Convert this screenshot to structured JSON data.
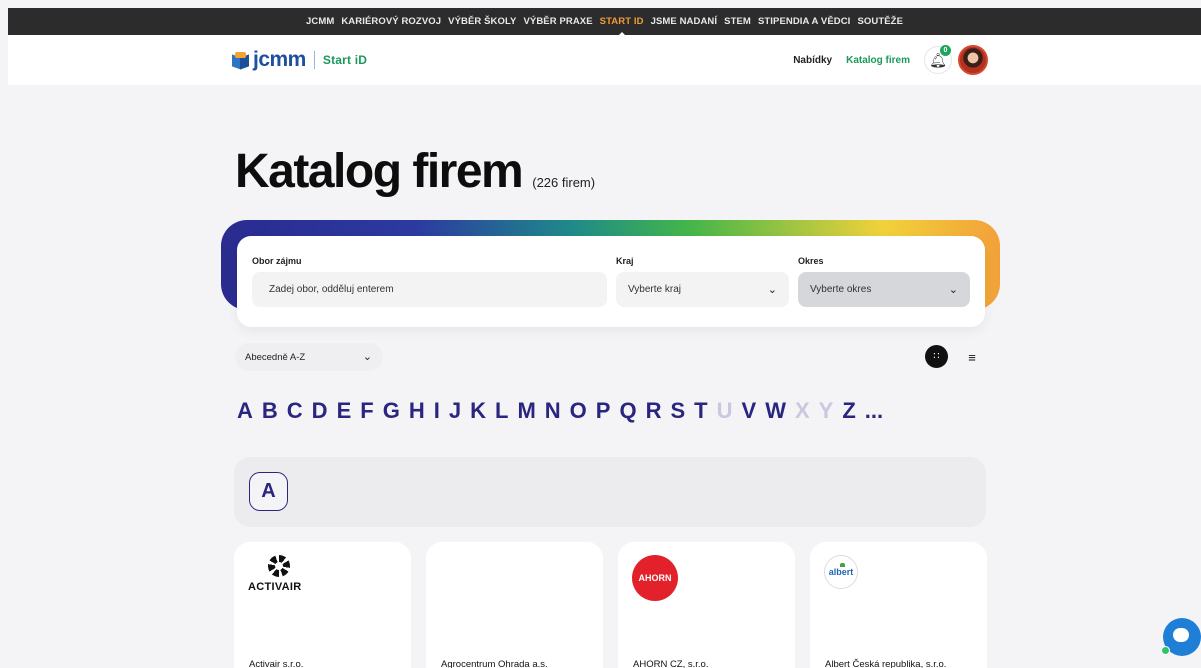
{
  "topnav": {
    "items": [
      {
        "label": "JCMM",
        "active": false
      },
      {
        "label": "KARIÉROVÝ ROZVOJ",
        "active": false
      },
      {
        "label": "VÝBĚR ŠKOLY",
        "active": false
      },
      {
        "label": "VÝBĚR PRAXE",
        "active": false
      },
      {
        "label": "START ID",
        "active": true
      },
      {
        "label": "JSME NADANÍ",
        "active": false
      },
      {
        "label": "STEM",
        "active": false
      },
      {
        "label": "STIPENDIA A VĚDCI",
        "active": false
      },
      {
        "label": "SOUTĚŽE",
        "active": false
      }
    ],
    "active_color": "#f39a3c"
  },
  "header": {
    "logo_text": "jcmm",
    "logo_sub": "Start iD",
    "links": [
      {
        "label": "Nabídky",
        "active": false
      },
      {
        "label": "Katalog firem",
        "active": true
      }
    ],
    "notification_count": "0",
    "bell_icon": "bell-icon",
    "accent": "#1a9a5a"
  },
  "page": {
    "title": "Katalog firem",
    "count": "(226 firem)"
  },
  "filters": {
    "interest_label": "Obor zájmu",
    "interest_placeholder": "Zadej obor, odděluj enterem",
    "region_label": "Kraj",
    "region_value": "Vyberte kraj",
    "district_label": "Okres",
    "district_value": "Vyberte okres"
  },
  "sort": {
    "value": "Abecedně A-Z"
  },
  "view_toggle": {
    "grid_icon": "grid-icon",
    "list_icon": "list-icon",
    "active": "grid"
  },
  "alphabet": [
    {
      "letter": "A",
      "enabled": true
    },
    {
      "letter": "B",
      "enabled": true
    },
    {
      "letter": "C",
      "enabled": true
    },
    {
      "letter": "D",
      "enabled": true
    },
    {
      "letter": "E",
      "enabled": true
    },
    {
      "letter": "F",
      "enabled": true
    },
    {
      "letter": "G",
      "enabled": true
    },
    {
      "letter": "H",
      "enabled": true
    },
    {
      "letter": "I",
      "enabled": true
    },
    {
      "letter": "J",
      "enabled": true
    },
    {
      "letter": "K",
      "enabled": true
    },
    {
      "letter": "L",
      "enabled": true
    },
    {
      "letter": "M",
      "enabled": true
    },
    {
      "letter": "N",
      "enabled": true
    },
    {
      "letter": "O",
      "enabled": true
    },
    {
      "letter": "P",
      "enabled": true
    },
    {
      "letter": "Q",
      "enabled": true
    },
    {
      "letter": "R",
      "enabled": true
    },
    {
      "letter": "S",
      "enabled": true
    },
    {
      "letter": "T",
      "enabled": true
    },
    {
      "letter": "U",
      "enabled": false
    },
    {
      "letter": "V",
      "enabled": true
    },
    {
      "letter": "W",
      "enabled": true
    },
    {
      "letter": "X",
      "enabled": false
    },
    {
      "letter": "Y",
      "enabled": false
    },
    {
      "letter": "Z",
      "enabled": true
    },
    {
      "letter": "...",
      "enabled": true
    }
  ],
  "section": {
    "letter": "A"
  },
  "companies": [
    {
      "name": "Activair s.r.o.",
      "logo": "activair-logo",
      "logo_text": "ACTIVAIR"
    },
    {
      "name": "Agrocentrum Ohrada a.s.",
      "logo": "none",
      "logo_text": ""
    },
    {
      "name": "AHORN CZ, s.r.o.",
      "logo": "ahorn-logo",
      "logo_text": "AHORN"
    },
    {
      "name": "Albert Česká republika, s.r.o.",
      "logo": "albert-logo",
      "logo_text": "albert"
    }
  ],
  "chat": {
    "icon": "chat-icon"
  }
}
